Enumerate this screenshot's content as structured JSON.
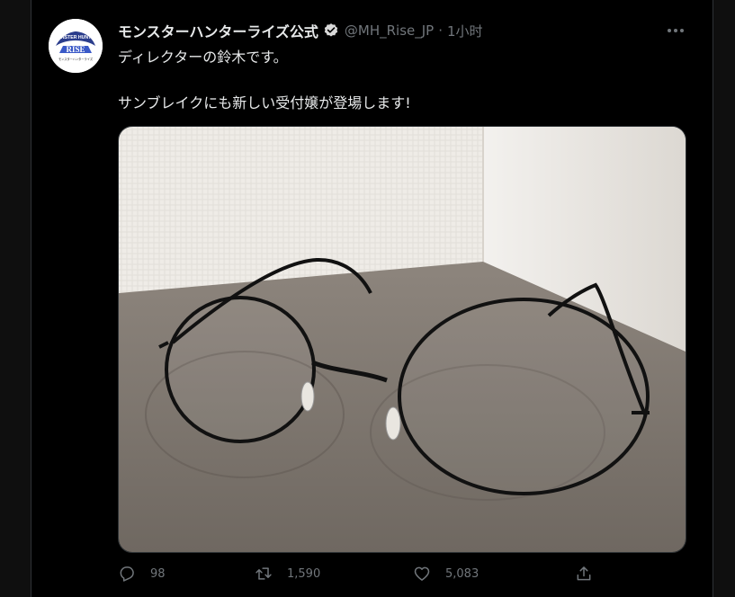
{
  "tweet": {
    "author_name": "モンスターハンターライズ公式",
    "handle": "@MH_Rise_JP",
    "separator": "·",
    "time": "1小时",
    "text_line1": "ディレクターの鈴木です。",
    "text_line2": "サンブレイクにも新しい受付嬢が登場します!",
    "avatar": {
      "logo_top": "MONSTER HUNTER",
      "logo_main": "RISE",
      "logo_caption": "モンスターハンターライズ"
    },
    "media": {
      "subject": "round-glasses-photo"
    }
  },
  "actions": {
    "reply_count": "98",
    "retweet_count": "1,590",
    "like_count": "5,083"
  },
  "icons": {
    "verified": "verified-badge-icon",
    "more": "more-icon",
    "reply": "reply-icon",
    "retweet": "retweet-icon",
    "like": "like-icon",
    "share": "share-icon"
  },
  "colors": {
    "background": "#000000",
    "text": "#e7e9ea",
    "muted": "#71767b",
    "border": "#2f3336"
  }
}
